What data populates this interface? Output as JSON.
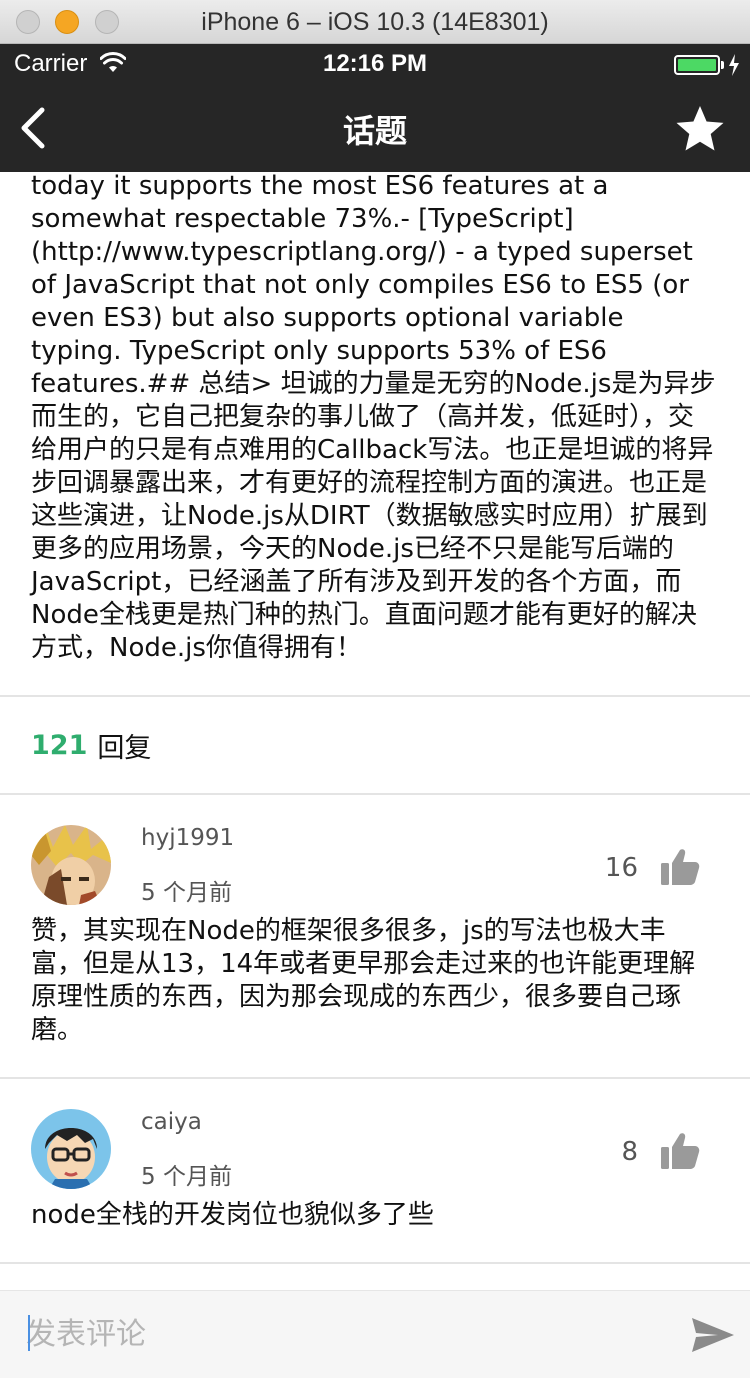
{
  "simulator": {
    "title": "iPhone 6 – iOS 10.3 (14E8301)"
  },
  "statusbar": {
    "carrier": "Carrier",
    "time": "12:16 PM",
    "battery_level": 1.0
  },
  "nav": {
    "title": "话题",
    "back_icon": "chevron-left-icon",
    "favorite_icon": "star-icon"
  },
  "article": {
    "text": "today it supports the most ES6 features at a somewhat respectable 73%.- [TypeScript](http://www.typescriptlang.org/) - a typed superset of JavaScript that not only compiles ES6 to ES5 (or even ES3) but also supports optional variable typing. TypeScript only supports 53% of ES6 features.## 总结> 坦诚的力量是无穷的Node.js是为异步而生的，它自己把复杂的事儿做了（高并发，低延时），交给用户的只是有点难用的Callback写法。也正是坦诚的将异步回调暴露出来，才有更好的流程控制方面的演进。也正是这些演进，让Node.js从DIRT（数据敏感实时应用）扩展到更多的应用场景，今天的Node.js已经不只是能写后端的JavaScript，已经涵盖了所有涉及到开发的各个方面，而Node全栈更是热门种的热门。直面问题才能有更好的解决方式，Node.js你值得拥有！"
  },
  "replies": {
    "count": "121",
    "label": "回复"
  },
  "comments": [
    {
      "user": "hyj1991",
      "time": "5 个月前",
      "likes": "16",
      "text": "赞，其实现在Node的框架很多很多，js的写法也极大丰富，但是从13，14年或者更早那会走过来的也许能更理解原理性质的东西，因为那会现成的东西少，很多要自己琢磨。"
    },
    {
      "user": "caiya",
      "time": "5 个月前",
      "likes": "8",
      "text": "node全栈的开发岗位也貌似多了些"
    }
  ],
  "composer": {
    "placeholder": "发表评论",
    "send_icon": "send-icon"
  },
  "colors": {
    "nav_bg": "#262626",
    "accent_green": "#2fad6e",
    "divider": "#e4e4e4"
  }
}
